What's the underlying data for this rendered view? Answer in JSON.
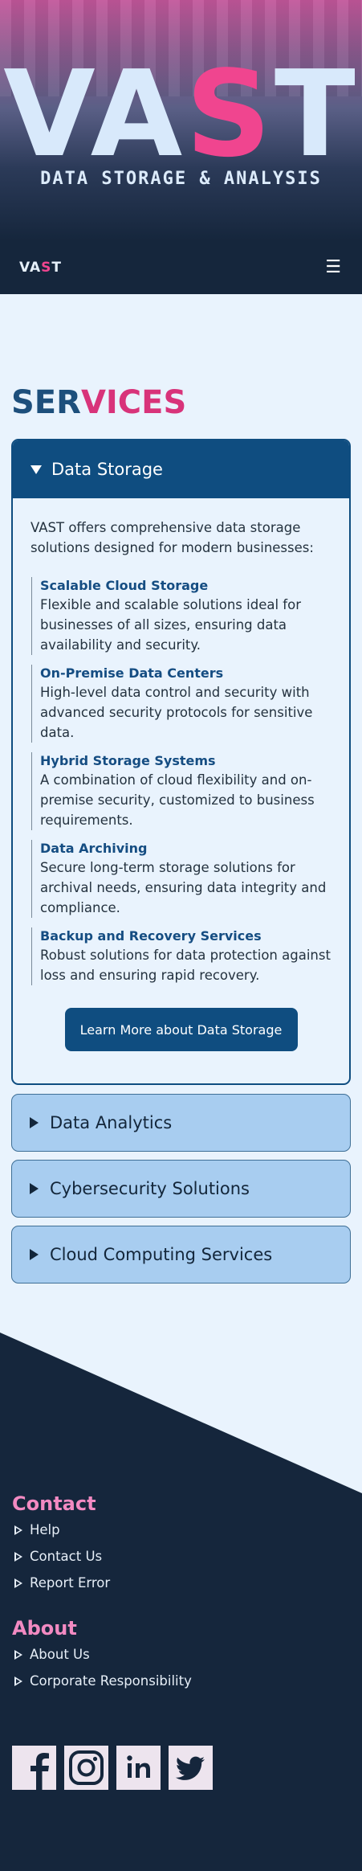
{
  "hero": {
    "title_pre": "VA",
    "title_pink": "S",
    "title_post": "T",
    "subtitle": "DATA STORAGE & ANALYSIS"
  },
  "navbar": {
    "brand_pre": "VA",
    "brand_pink": "S",
    "brand_post": "T",
    "menu_glyph": "☰"
  },
  "services": {
    "title_a": "SER",
    "title_b": "VICES",
    "open_panel": {
      "label": "Data Storage",
      "intro": "VAST offers comprehensive data storage solutions designed for modern businesses:",
      "items": [
        {
          "title": "Scalable Cloud Storage",
          "desc": "Flexible and scalable solutions ideal for businesses of all sizes, ensuring data availability and security."
        },
        {
          "title": "On-Premise Data Centers",
          "desc": "High-level data control and security with advanced security protocols for sensitive data."
        },
        {
          "title": "Hybrid Storage Systems",
          "desc": "A combination of cloud flexibility and on-premise security, customized to business requirements."
        },
        {
          "title": "Data Archiving",
          "desc": "Secure long-term storage solutions for archival needs, ensuring data integrity and compliance."
        },
        {
          "title": "Backup and Recovery Services",
          "desc": "Robust solutions for data protection against loss and ensuring rapid recovery."
        }
      ],
      "button": "Learn More about Data Storage"
    },
    "closed_panels": [
      {
        "label": "Data Analytics"
      },
      {
        "label": "Cybersecurity Solutions"
      },
      {
        "label": "Cloud Computing Services"
      }
    ]
  },
  "footer": {
    "contact_heading": "Contact",
    "contact_links": [
      "Help",
      "Contact Us",
      "Report Error"
    ],
    "about_heading": "About",
    "about_links": [
      "About Us",
      "Corporate Responsibility"
    ],
    "social": [
      "facebook-icon",
      "instagram-icon",
      "linkedin-icon",
      "twitter-icon"
    ]
  },
  "colors": {
    "accent_pink": "#f0458f",
    "navy": "#0f4d80",
    "footer_bg": "#15263c",
    "panel_closed": "#a8cdf0"
  }
}
